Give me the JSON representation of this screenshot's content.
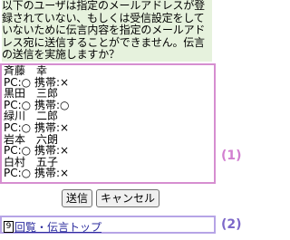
{
  "notice": "以下のユーザは指定のメールアドレスが登録されていない、もしくは受信設定をしていないために伝言内容を指定のメールアドレス宛に送信することができません。伝言の送信を実施しますか？",
  "users": [
    {
      "name": "斉藤　幸",
      "status": "PC:○ 携帯:×"
    },
    {
      "name": "黒田　三郎",
      "status": "PC:○ 携帯:○"
    },
    {
      "name": "緑川　二郎",
      "status": "PC:○ 携帯:×"
    },
    {
      "name": "岩本　六朗",
      "status": "PC:○ 携帯:×"
    },
    {
      "name": "白村　五子",
      "status": "PC:○ 携帯:×"
    }
  ],
  "annotations": {
    "label1": "(1)",
    "label2": "(2)"
  },
  "buttons": {
    "send": "送信",
    "cancel": "キャンセル"
  },
  "footer": {
    "icon_num": "9",
    "link_text": "回覧・伝言トップ"
  }
}
